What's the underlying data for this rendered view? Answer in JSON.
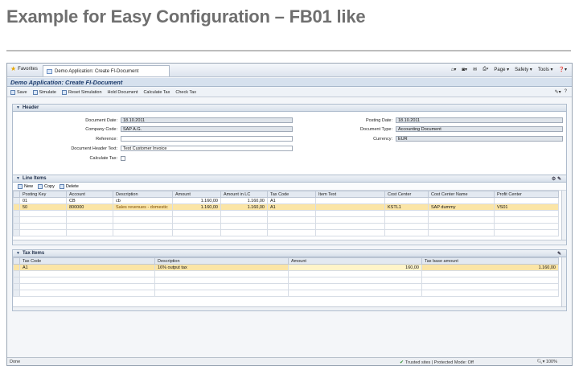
{
  "slide": {
    "title": "Example for Easy Configuration – FB01 like"
  },
  "browser": {
    "favorites": "Favorites",
    "tab": "Demo Application: Create FI-Document",
    "tools": [
      "Page ▾",
      "Safety ▾",
      "Tools ▾"
    ],
    "status_left": "Done",
    "status_trust": "Trusted sites | Protected Mode: Off",
    "zoom": "100%"
  },
  "app": {
    "title": "Demo Application: Create FI-Document",
    "toolbar": [
      "Save",
      "Simulate",
      "Reset Simulation",
      "Hold Document",
      "Calculate Tax",
      "Check Tax"
    ]
  },
  "header": {
    "title": "Header",
    "document_date": {
      "label": "Document Date:",
      "value": "18.10.2011"
    },
    "company_code": {
      "label": "Company Code:",
      "value": "SAP A.G."
    },
    "reference": {
      "label": "Reference:",
      "value": ""
    },
    "header_text": {
      "label": "Document Header Text:",
      "value": "Test Customer Invoice"
    },
    "calculate_tax": {
      "label": "Calculate Tax:"
    },
    "posting_date": {
      "label": "Posting Date:",
      "value": "18.10.2011"
    },
    "document_type": {
      "label": "Document Type:",
      "value": "Accounting Document"
    },
    "currency": {
      "label": "Currency:",
      "value": "EUR"
    }
  },
  "line_items": {
    "title": "Line Items",
    "actions": [
      "New",
      "Copy",
      "Delete"
    ],
    "columns": [
      "Posting Key",
      "Account",
      "Description",
      "Amount",
      "Amount in LC",
      "Tax Code",
      "Item Text",
      "Cost Center",
      "Cost Center Name",
      "Profit Center"
    ],
    "rows": [
      [
        "01",
        "CB",
        "cb",
        "1.160,00",
        "1.160,00",
        "A1",
        "",
        "",
        "",
        ""
      ],
      [
        "50",
        "800000",
        "Sales revenues - domestic",
        "1.160,00",
        "1.160,00",
        "A1",
        "",
        "KSTL1",
        "SAP dummy",
        "VS01"
      ]
    ]
  },
  "tax_items": {
    "title": "Tax Items",
    "columns": [
      "Tax Code",
      "Description",
      "Amount",
      "Tax base amount"
    ],
    "rows": [
      [
        "A1",
        "16% output tax",
        "160,00",
        "1.160,00"
      ]
    ]
  },
  "colors": {
    "selected_row": "#fbe5a6",
    "title_blue": "#1b3a6b"
  }
}
